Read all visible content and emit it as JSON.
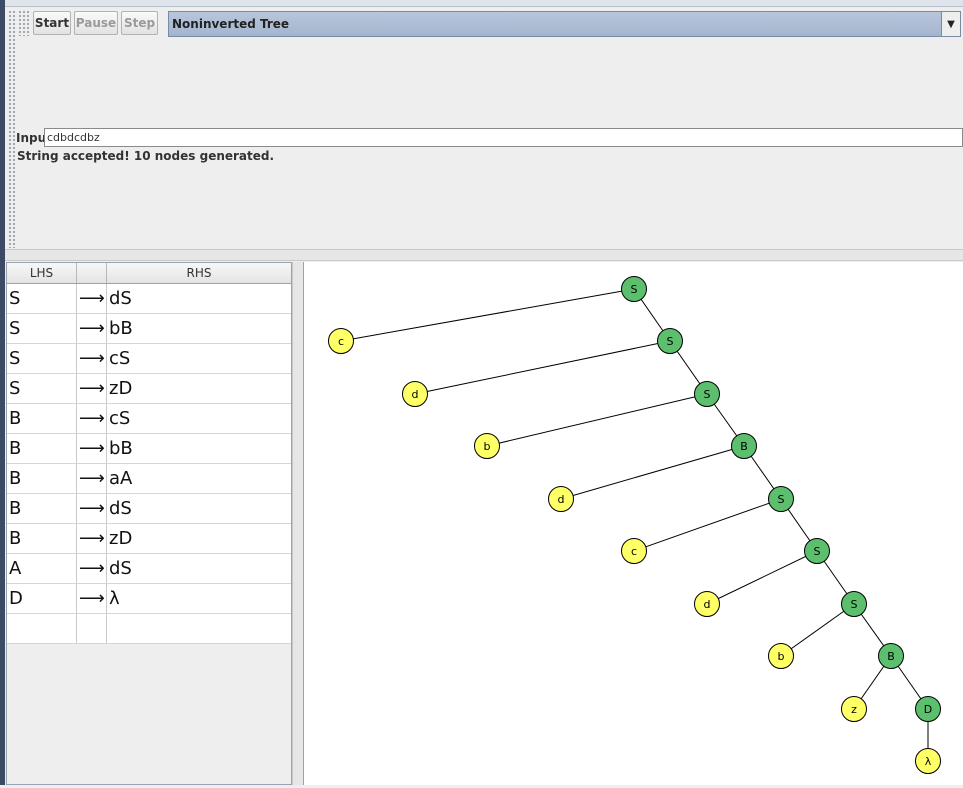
{
  "toolbar": {
    "start_label": "Start",
    "pause_label": "Pause",
    "step_label": "Step",
    "view_mode": "Noninverted Tree"
  },
  "input": {
    "label": "Input",
    "value": "cdbdcdbz"
  },
  "status": "String accepted!  10 nodes generated.",
  "grammar": {
    "headers": {
      "lhs": "LHS",
      "arrow": "",
      "rhs": "RHS"
    },
    "rows": [
      {
        "lhs": "S",
        "arrow": "⟶",
        "rhs": "dS"
      },
      {
        "lhs": "S",
        "arrow": "⟶",
        "rhs": "bB"
      },
      {
        "lhs": "S",
        "arrow": "⟶",
        "rhs": "cS"
      },
      {
        "lhs": "S",
        "arrow": "⟶",
        "rhs": "zD"
      },
      {
        "lhs": "B",
        "arrow": "⟶",
        "rhs": "cS"
      },
      {
        "lhs": "B",
        "arrow": "⟶",
        "rhs": "bB"
      },
      {
        "lhs": "B",
        "arrow": "⟶",
        "rhs": "aA"
      },
      {
        "lhs": "B",
        "arrow": "⟶",
        "rhs": "dS"
      },
      {
        "lhs": "B",
        "arrow": "⟶",
        "rhs": "zD"
      },
      {
        "lhs": "A",
        "arrow": "⟶",
        "rhs": "dS"
      },
      {
        "lhs": "D",
        "arrow": "⟶",
        "rhs": "λ"
      },
      {
        "lhs": "",
        "arrow": "",
        "rhs": ""
      }
    ]
  },
  "parse_tree": {
    "colors": {
      "nonterminal": "#5cbf6e",
      "terminal": "#ffff66",
      "edge": "#000000"
    },
    "nodes": [
      {
        "id": "n0",
        "label": "S",
        "kind": "nonterminal"
      },
      {
        "id": "t0",
        "label": "c",
        "kind": "terminal"
      },
      {
        "id": "n1",
        "label": "S",
        "kind": "nonterminal"
      },
      {
        "id": "t1",
        "label": "d",
        "kind": "terminal"
      },
      {
        "id": "n2",
        "label": "S",
        "kind": "nonterminal"
      },
      {
        "id": "t2",
        "label": "b",
        "kind": "terminal"
      },
      {
        "id": "n3",
        "label": "B",
        "kind": "nonterminal"
      },
      {
        "id": "t3",
        "label": "d",
        "kind": "terminal"
      },
      {
        "id": "n4",
        "label": "S",
        "kind": "nonterminal"
      },
      {
        "id": "t4",
        "label": "c",
        "kind": "terminal"
      },
      {
        "id": "n5",
        "label": "S",
        "kind": "nonterminal"
      },
      {
        "id": "t5",
        "label": "d",
        "kind": "terminal"
      },
      {
        "id": "n6",
        "label": "S",
        "kind": "nonterminal"
      },
      {
        "id": "t6",
        "label": "b",
        "kind": "terminal"
      },
      {
        "id": "n7",
        "label": "B",
        "kind": "nonterminal"
      },
      {
        "id": "t7",
        "label": "z",
        "kind": "terminal"
      },
      {
        "id": "n8",
        "label": "D",
        "kind": "nonterminal"
      },
      {
        "id": "t8",
        "label": "λ",
        "kind": "terminal"
      }
    ]
  }
}
